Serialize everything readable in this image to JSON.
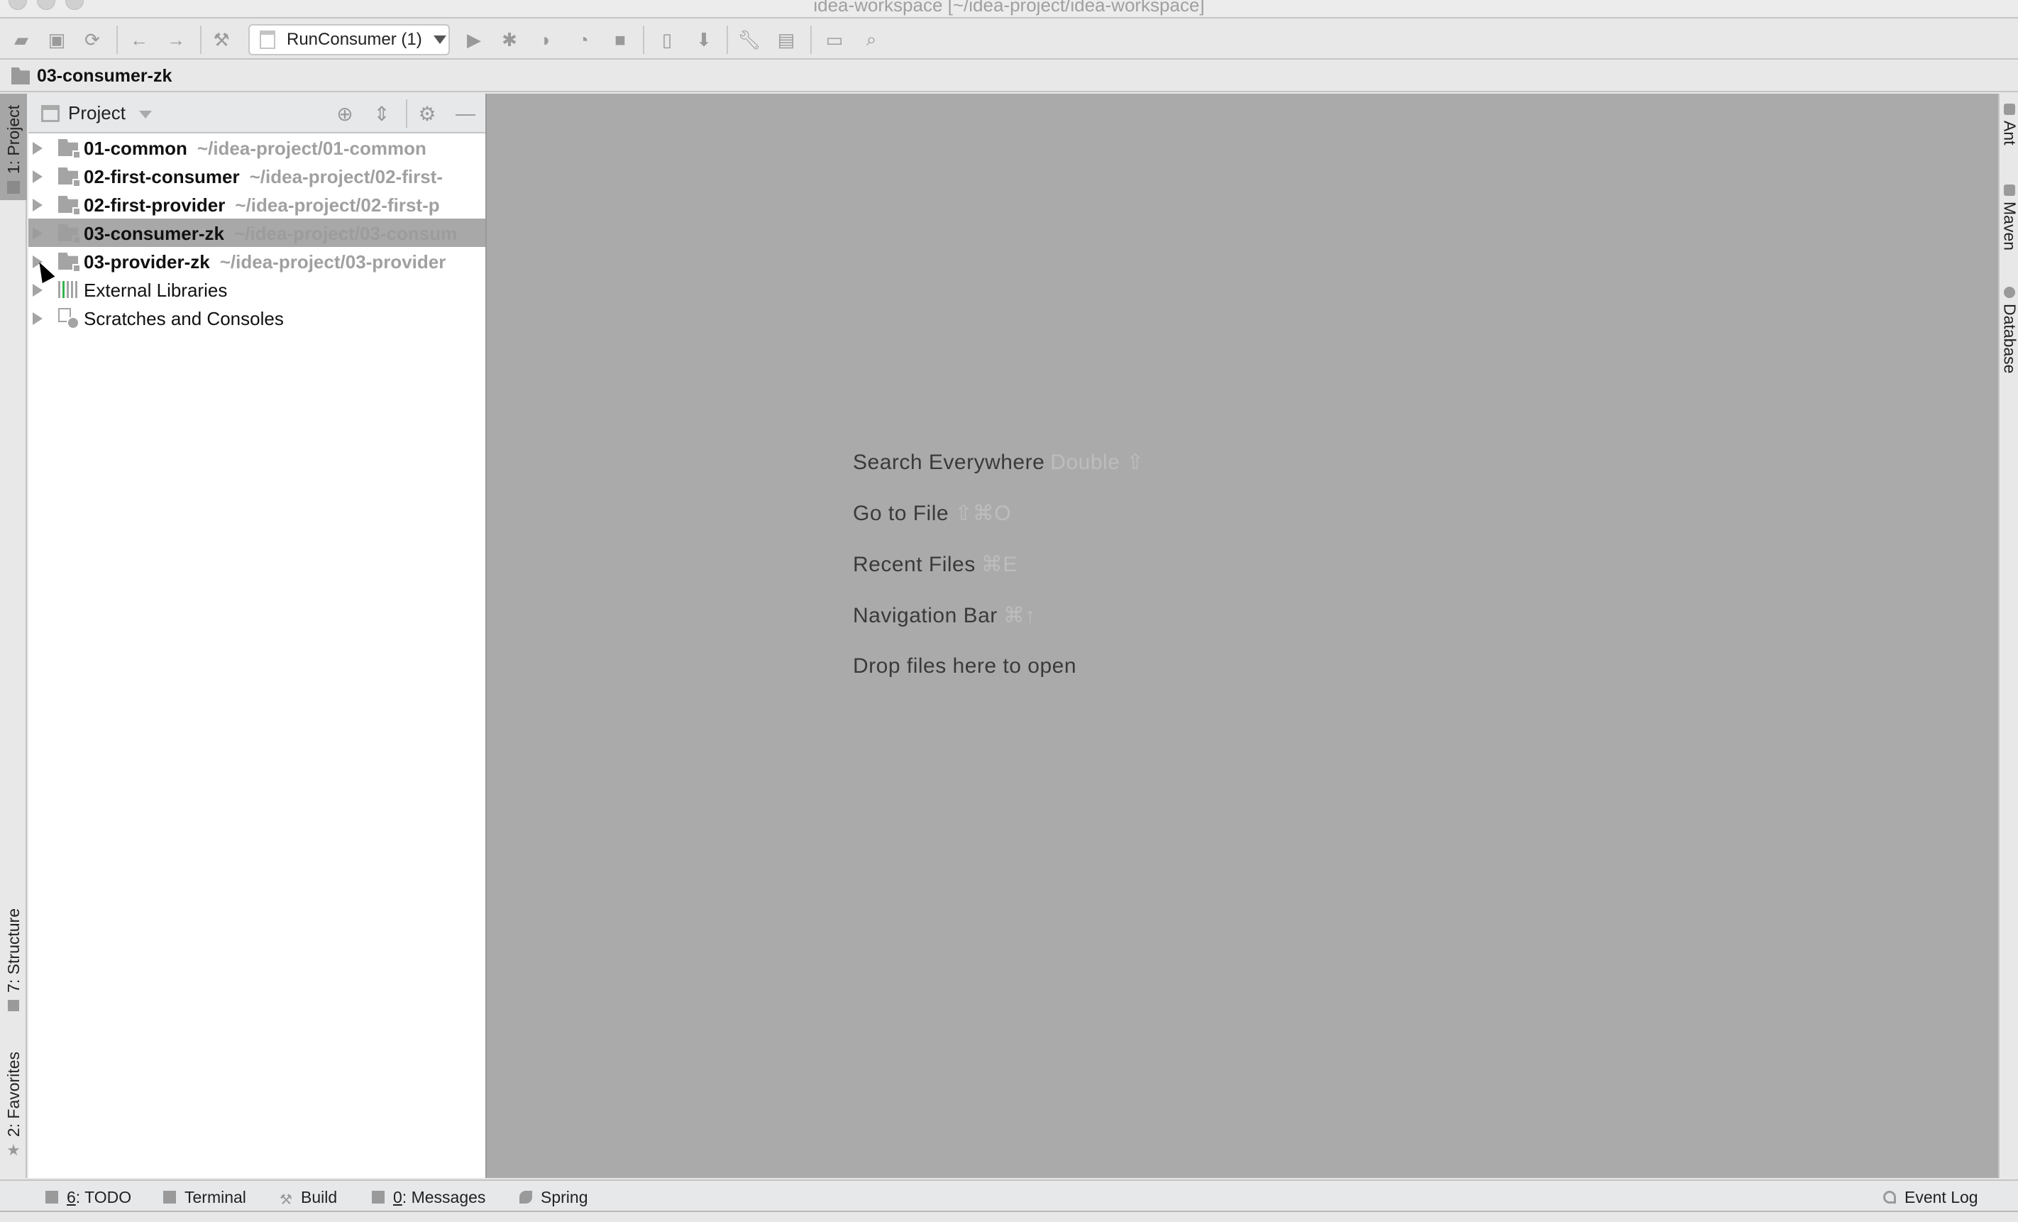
{
  "window": {
    "title": "idea-workspace [~/idea-project/idea-workspace]"
  },
  "toolbar": {
    "run_config_label": "RunConsumer (1)",
    "icons": [
      "open-folder-icon",
      "save-icon",
      "sync-icon",
      "back-icon",
      "forward-icon",
      "build-hammer-icon",
      "run-icon",
      "debug-icon",
      "run-with-coverage-icon",
      "profile-icon",
      "stop-icon",
      "device-icon",
      "sdk-download-icon",
      "settings-wrench-icon",
      "project-structure-icon",
      "presentation-icon",
      "search-icon"
    ]
  },
  "navbar": {
    "breadcrumb": "03-consumer-zk"
  },
  "left_stripe": {
    "project_tab": "1: Project",
    "structure_tab": "7: Structure",
    "favorites_tab": "2: Favorites"
  },
  "project_panel": {
    "title": "Project",
    "tree": [
      {
        "name": "01-common",
        "path": "~/idea-project/01-common",
        "type": "module"
      },
      {
        "name": "02-first-consumer",
        "path": "~/idea-project/02-first-",
        "type": "module"
      },
      {
        "name": "02-first-provider",
        "path": "~/idea-project/02-first-p",
        "type": "module"
      },
      {
        "name": "03-consumer-zk",
        "path": "~/idea-project/03-consum",
        "type": "module",
        "selected": true
      },
      {
        "name": "03-provider-zk",
        "path": "~/idea-project/03-provider",
        "type": "module"
      },
      {
        "name": "External Libraries",
        "type": "libraries"
      },
      {
        "name": "Scratches and Consoles",
        "type": "scratches"
      }
    ]
  },
  "editor": {
    "hints": [
      {
        "label": "Search Everywhere",
        "shortcut": "Double ⇧"
      },
      {
        "label": "Go to File",
        "shortcut": "⇧⌘O"
      },
      {
        "label": "Recent Files",
        "shortcut": "⌘E"
      },
      {
        "label": "Navigation Bar",
        "shortcut": "⌘↑"
      },
      {
        "label": "Drop files here to open",
        "shortcut": ""
      }
    ]
  },
  "right_stripe": {
    "tabs": [
      "Ant",
      "Maven",
      "Database"
    ]
  },
  "bottom_bar": {
    "todo": {
      "mnemonic": "6",
      "label": ": TODO"
    },
    "terminal": "Terminal",
    "build": "Build",
    "messages": {
      "mnemonic": "0",
      "label": ": Messages"
    },
    "spring": "Spring",
    "event_log": "Event Log"
  },
  "colors": {
    "editor_bg": "#aaaaaa",
    "selection_bg": "#a8a8a8",
    "libraries_accent": "#35b34a"
  }
}
